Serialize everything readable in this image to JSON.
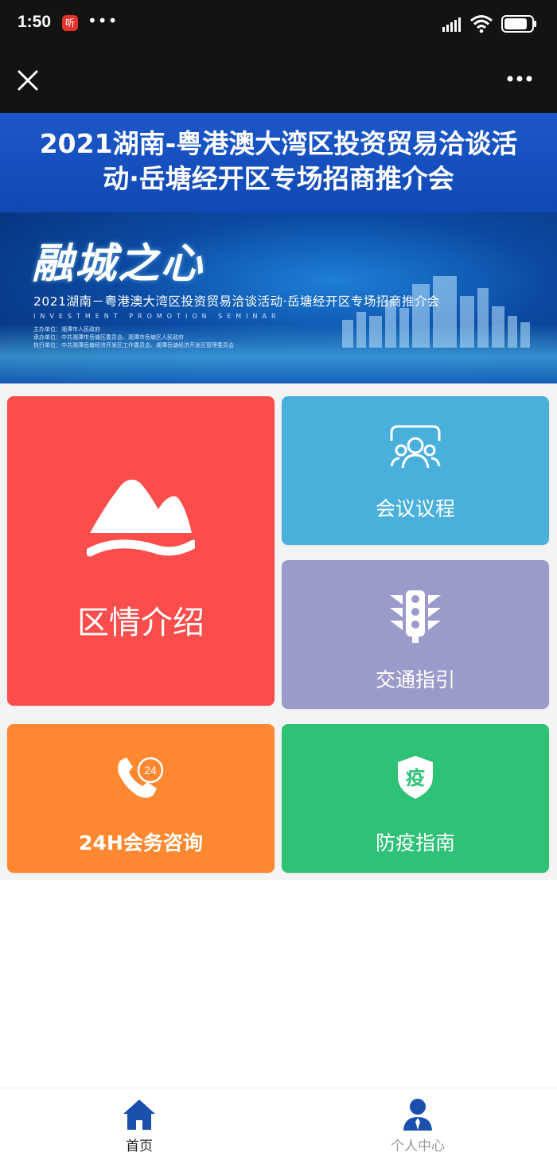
{
  "status_bar": {
    "time": "1:50",
    "app_badge": "听",
    "overflow_dots": "•••"
  },
  "nav": {
    "more_label": "•••"
  },
  "title_banner": {
    "line1": "2021湖南-粤港澳大湾区投资贸易洽谈活",
    "line2": "动·岳塘经开区专场招商推介会"
  },
  "hero": {
    "heading": "融城之心",
    "subtitle": "2021湖南－粤港澳大湾区投资贸易洽谈活动·岳塘经开区专场招商推介会",
    "english": "INVESTMENT  PROMOTION  SEMINAR",
    "org_lines": [
      "主办单位：湘潭市人民政府",
      "承办单位：中共湘潭市岳塘区委员会、湘潭市岳塘区人民政府",
      "执行单位：中共湘潭岳塘经济开发区工作委员会、湘潭岳塘经济开发区管理委员会"
    ]
  },
  "tiles": {
    "district": {
      "label": "区情介绍",
      "icon": "mountain-icon"
    },
    "agenda": {
      "label": "会议议程",
      "icon": "people-icon"
    },
    "traffic": {
      "label": "交通指引",
      "icon": "traffic-light-icon"
    },
    "consult": {
      "label": "24H会务咨询",
      "icon": "phone-24-icon",
      "icon_text": "24"
    },
    "epidemic": {
      "label": "防疫指南",
      "icon": "shield-icon",
      "icon_text": "疫"
    }
  },
  "tab_bar": {
    "home": {
      "label": "首页",
      "icon": "home-icon"
    },
    "me": {
      "label": "个人中心",
      "icon": "user-icon"
    }
  },
  "colors": {
    "district": "#fb4d4b",
    "agenda": "#49b0dc",
    "traffic": "#9a9bcb",
    "consult": "#ff8830",
    "epidemic": "#2fc176",
    "tab_active": "#1a4fae"
  }
}
